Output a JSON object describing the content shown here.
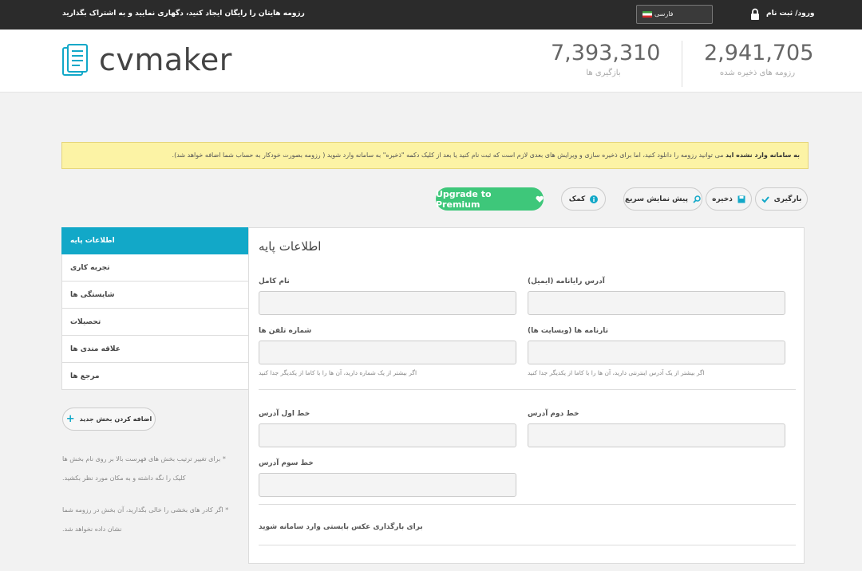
{
  "topbar": {
    "tagline": "رزومه هایتان را رایگان ایجاد کنید، دگهاری نمایید و به اشتراک بگذارید",
    "language": "فارسی",
    "login": "ورود/ ثبت نام"
  },
  "header": {
    "logo": "cvmaker",
    "downloads": {
      "value": "7,393,310",
      "label": "بازگیری ها"
    },
    "saved": {
      "value": "2,941,705",
      "label": "رزومه های ذخیره شده"
    }
  },
  "notice": {
    "bold": "به سامانه وارد نشده اید",
    "text": "می توانید رزومه را دانلود کنید، اما برای ذخیره سازی و ویرایش های بعدی لازم است که ثبت نام کنید یا بعد از کلیک دکمه \"ذخیره\" به سامانه وارد شوید ( رزومه بصورت خودکار به حساب شما اضافه خواهد شد)."
  },
  "toolbar": {
    "download": "بارگیری",
    "save": "ذخیره",
    "preview": "پیش نمایش سریع",
    "help": "کمک",
    "premium": "Upgrade to Premium"
  },
  "sidebar": {
    "items": [
      {
        "label": "اطلاعات پایه"
      },
      {
        "label": "تجربه کاری"
      },
      {
        "label": "شایستگی ها"
      },
      {
        "label": "تحصیلات"
      },
      {
        "label": "علاقه مندی ها"
      },
      {
        "label": "مرجع ها"
      }
    ],
    "add_section": "اضافه کردن بخش جدید",
    "note1_line1": "* برای تغییر ترتیب بخش های فهرست بالا بر روی نام بخش ها",
    "note1_line2": "کلیک را نگه داشته و به مکان مورد نظر بکشید.",
    "note2_line1": "* اگر کادر های بخشی را خالی بگذارید، آن بخش در رزومه شما",
    "note2_line2": "نشان داده نخواهد شد."
  },
  "form": {
    "title": "اطلاعات پایه",
    "full_name": {
      "label": "نام کامل",
      "value": ""
    },
    "email": {
      "label": "آدرس رایانامه (ایمیل)",
      "value": ""
    },
    "phone": {
      "label": "شماره تلفن ها",
      "value": "",
      "hint": "اگر بیشتر از یک شماره دارید، آن ها را با کاما از یکدیگر جدا کنید"
    },
    "website": {
      "label": "تارنامه ها (وبسایت ها)",
      "value": "",
      "hint": "اگر بیشتر از یک آدرس اینترنتی دارید، آن ها را با کاما از یکدیگر جدا کنید"
    },
    "address1": {
      "label": "خط اول آدرس",
      "value": ""
    },
    "address2": {
      "label": "خط دوم آدرس",
      "value": ""
    },
    "address3": {
      "label": "خط سوم آدرس",
      "value": ""
    },
    "photo_note": "برای بارگذاری عکس بایستی وارد سامانه شوید"
  },
  "colors": {
    "accent": "#12a8c8",
    "premium": "#3ec77a",
    "notice_bg": "#fcf3a5",
    "topbar": "#2b2b2b"
  }
}
